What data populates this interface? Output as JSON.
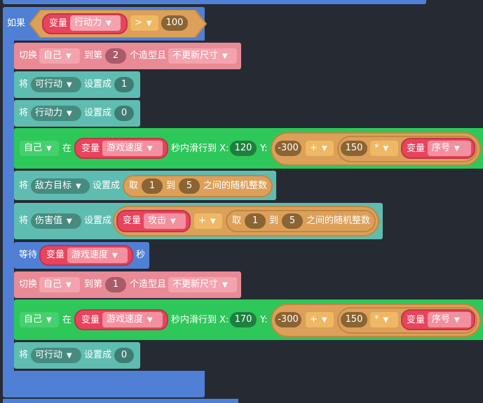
{
  "top_bar": {},
  "if_block": {
    "keyword": "如果",
    "var_label": "变量",
    "var_name": "行动力",
    "operator": ">",
    "value": "100"
  },
  "costume1": {
    "label": "切换",
    "target": "自己",
    "to": "到第",
    "index": "2",
    "suffix": "个造型且",
    "mode": "不更新尺寸"
  },
  "set1": {
    "prefix": "将",
    "var": "可行动",
    "mid": "设置成",
    "value": "1"
  },
  "set2": {
    "prefix": "将",
    "var": "行动力",
    "mid": "设置成",
    "value": "0"
  },
  "glide1": {
    "target": "自己",
    "in": "在",
    "var_label": "变量",
    "var_name": "游戏速度",
    "mid": "秒内滑行到 X:",
    "x": "120",
    "y_label": "Y:",
    "a": "-300",
    "op1": "+",
    "b": "150",
    "op2": "*",
    "var2_label": "变量",
    "var2_name": "序号"
  },
  "set3": {
    "prefix": "将",
    "var": "敌方目标",
    "mid": "设置成",
    "rand_label": "取",
    "from": "1",
    "to_label": "到",
    "to": "5",
    "rand_suffix": "之间的随机整数"
  },
  "set4": {
    "prefix": "将",
    "var": "伤害值",
    "mid": "设置成",
    "var_label": "变量",
    "var_name": "攻击",
    "op": "+",
    "rand_label": "取",
    "from": "1",
    "to_label": "到",
    "to": "5",
    "rand_suffix": "之间的随机整数"
  },
  "wait": {
    "label": "等待",
    "var_label": "变量",
    "var_name": "游戏速度",
    "suffix": "秒"
  },
  "costume2": {
    "label": "切换",
    "target": "自己",
    "to": "到第",
    "index": "1",
    "suffix": "个造型且",
    "mode": "不更新尺寸"
  },
  "glide2": {
    "target": "自己",
    "in": "在",
    "var_label": "变量",
    "var_name": "游戏速度",
    "mid": "秒内滑行到 X:",
    "x": "170",
    "y_label": "Y:",
    "a": "-300",
    "op1": "+",
    "b": "150",
    "op2": "*",
    "var2_label": "变量",
    "var2_name": "序号"
  },
  "set5": {
    "prefix": "将",
    "var": "可行动",
    "mid": "设置成",
    "value": "0"
  },
  "colors": {
    "control": "#4f80d6",
    "looks": "#e98a97",
    "data": "#5ebdb0",
    "motion": "#2ec75a",
    "operator": "#dca05a",
    "variable": "#e8445e"
  }
}
